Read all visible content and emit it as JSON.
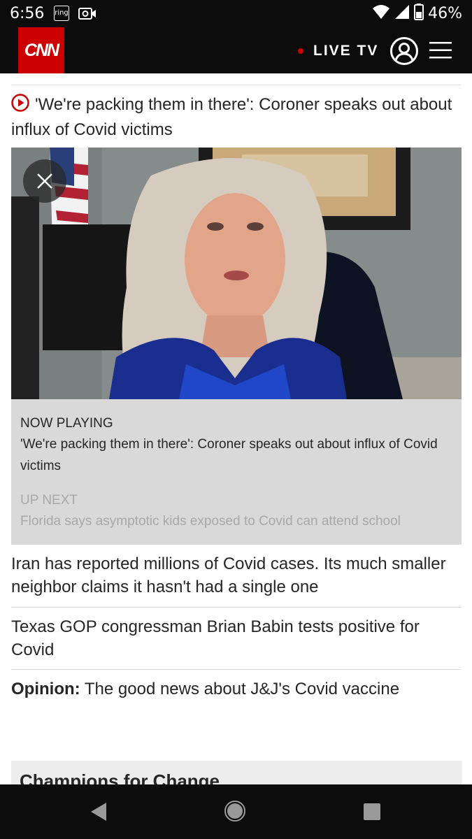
{
  "status_bar": {
    "time": "6:56",
    "ring_label": "ring",
    "battery": "46%"
  },
  "header": {
    "logo": "CNN",
    "live_tv": "LIVE TV"
  },
  "headlines": {
    "video_story": "'We're packing them in there': Coroner speaks out about influx of Covid victims",
    "item_iran": "Iran has reported millions of Covid cases. Its much smaller neighbor claims it hasn't had a single one",
    "item_texas": "Texas GOP congressman Brian Babin tests positive for Covid",
    "opinion_label": "Opinion:",
    "opinion_text": " The good news about J&J's Covid vaccine"
  },
  "video_panel": {
    "now_playing_label": "NOW PLAYING",
    "now_playing_title": "'We're packing them in there': Coroner speaks out about influx of Covid victims",
    "up_next_label": "UP NEXT",
    "up_next_title": "Florida says asymptotic kids exposed to Covid can attend school"
  },
  "section": {
    "champions_title": "Champions for Change"
  },
  "colors": {
    "brand_red": "#cc0000",
    "header_bg": "#0c0c0c",
    "panel_bg": "#d9d9d9",
    "muted_text": "#a8a8a8"
  }
}
